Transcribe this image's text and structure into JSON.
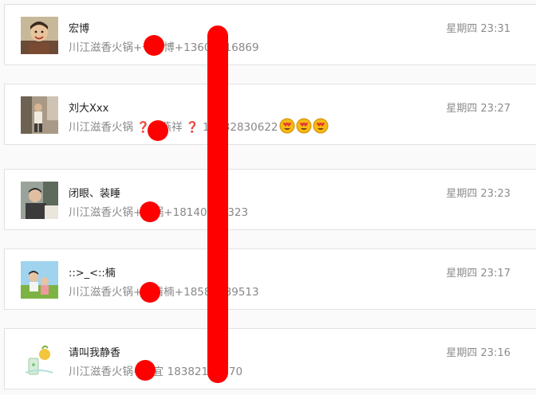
{
  "chats": [
    {
      "name": "宏博",
      "preview": "川江滋香火锅+一宏博+13608816869",
      "time": "星期四 23:31",
      "avatar_icon": "child-photo-avatar"
    },
    {
      "name": "刘大Xxx",
      "preview_before": "川江滋香火锅",
      "preview_mid": "一燕祥",
      "preview_after": "15882830622",
      "mark": "❓",
      "time": "星期四 23:27",
      "avatar_icon": "person-photo-avatar",
      "emojis": [
        "heart-eyes-emoji",
        "heart-eyes-emoji",
        "heart-eyes-emoji"
      ]
    },
    {
      "name": "闭眼、装睡",
      "preview": "川江滋香火锅+一锅+18140423323",
      "time": "星期四 23:23",
      "avatar_icon": "person-photo-avatar"
    },
    {
      "name": "::>_<::楠",
      "preview": "川江滋香火锅+一清楠+18582389513",
      "time": "星期四 23:17",
      "avatar_icon": "outdoor-photo-avatar"
    },
    {
      "name": "请叫我静香",
      "preview": "川江滋香火锅+静宜 18382111270",
      "time": "星期四 23:16",
      "avatar_icon": "illustration-avatar"
    }
  ],
  "colors": {
    "redaction": "#ff0000",
    "card_border": "#e2e2e2",
    "preview_text": "#888888",
    "time_text": "#8c8c8c"
  }
}
